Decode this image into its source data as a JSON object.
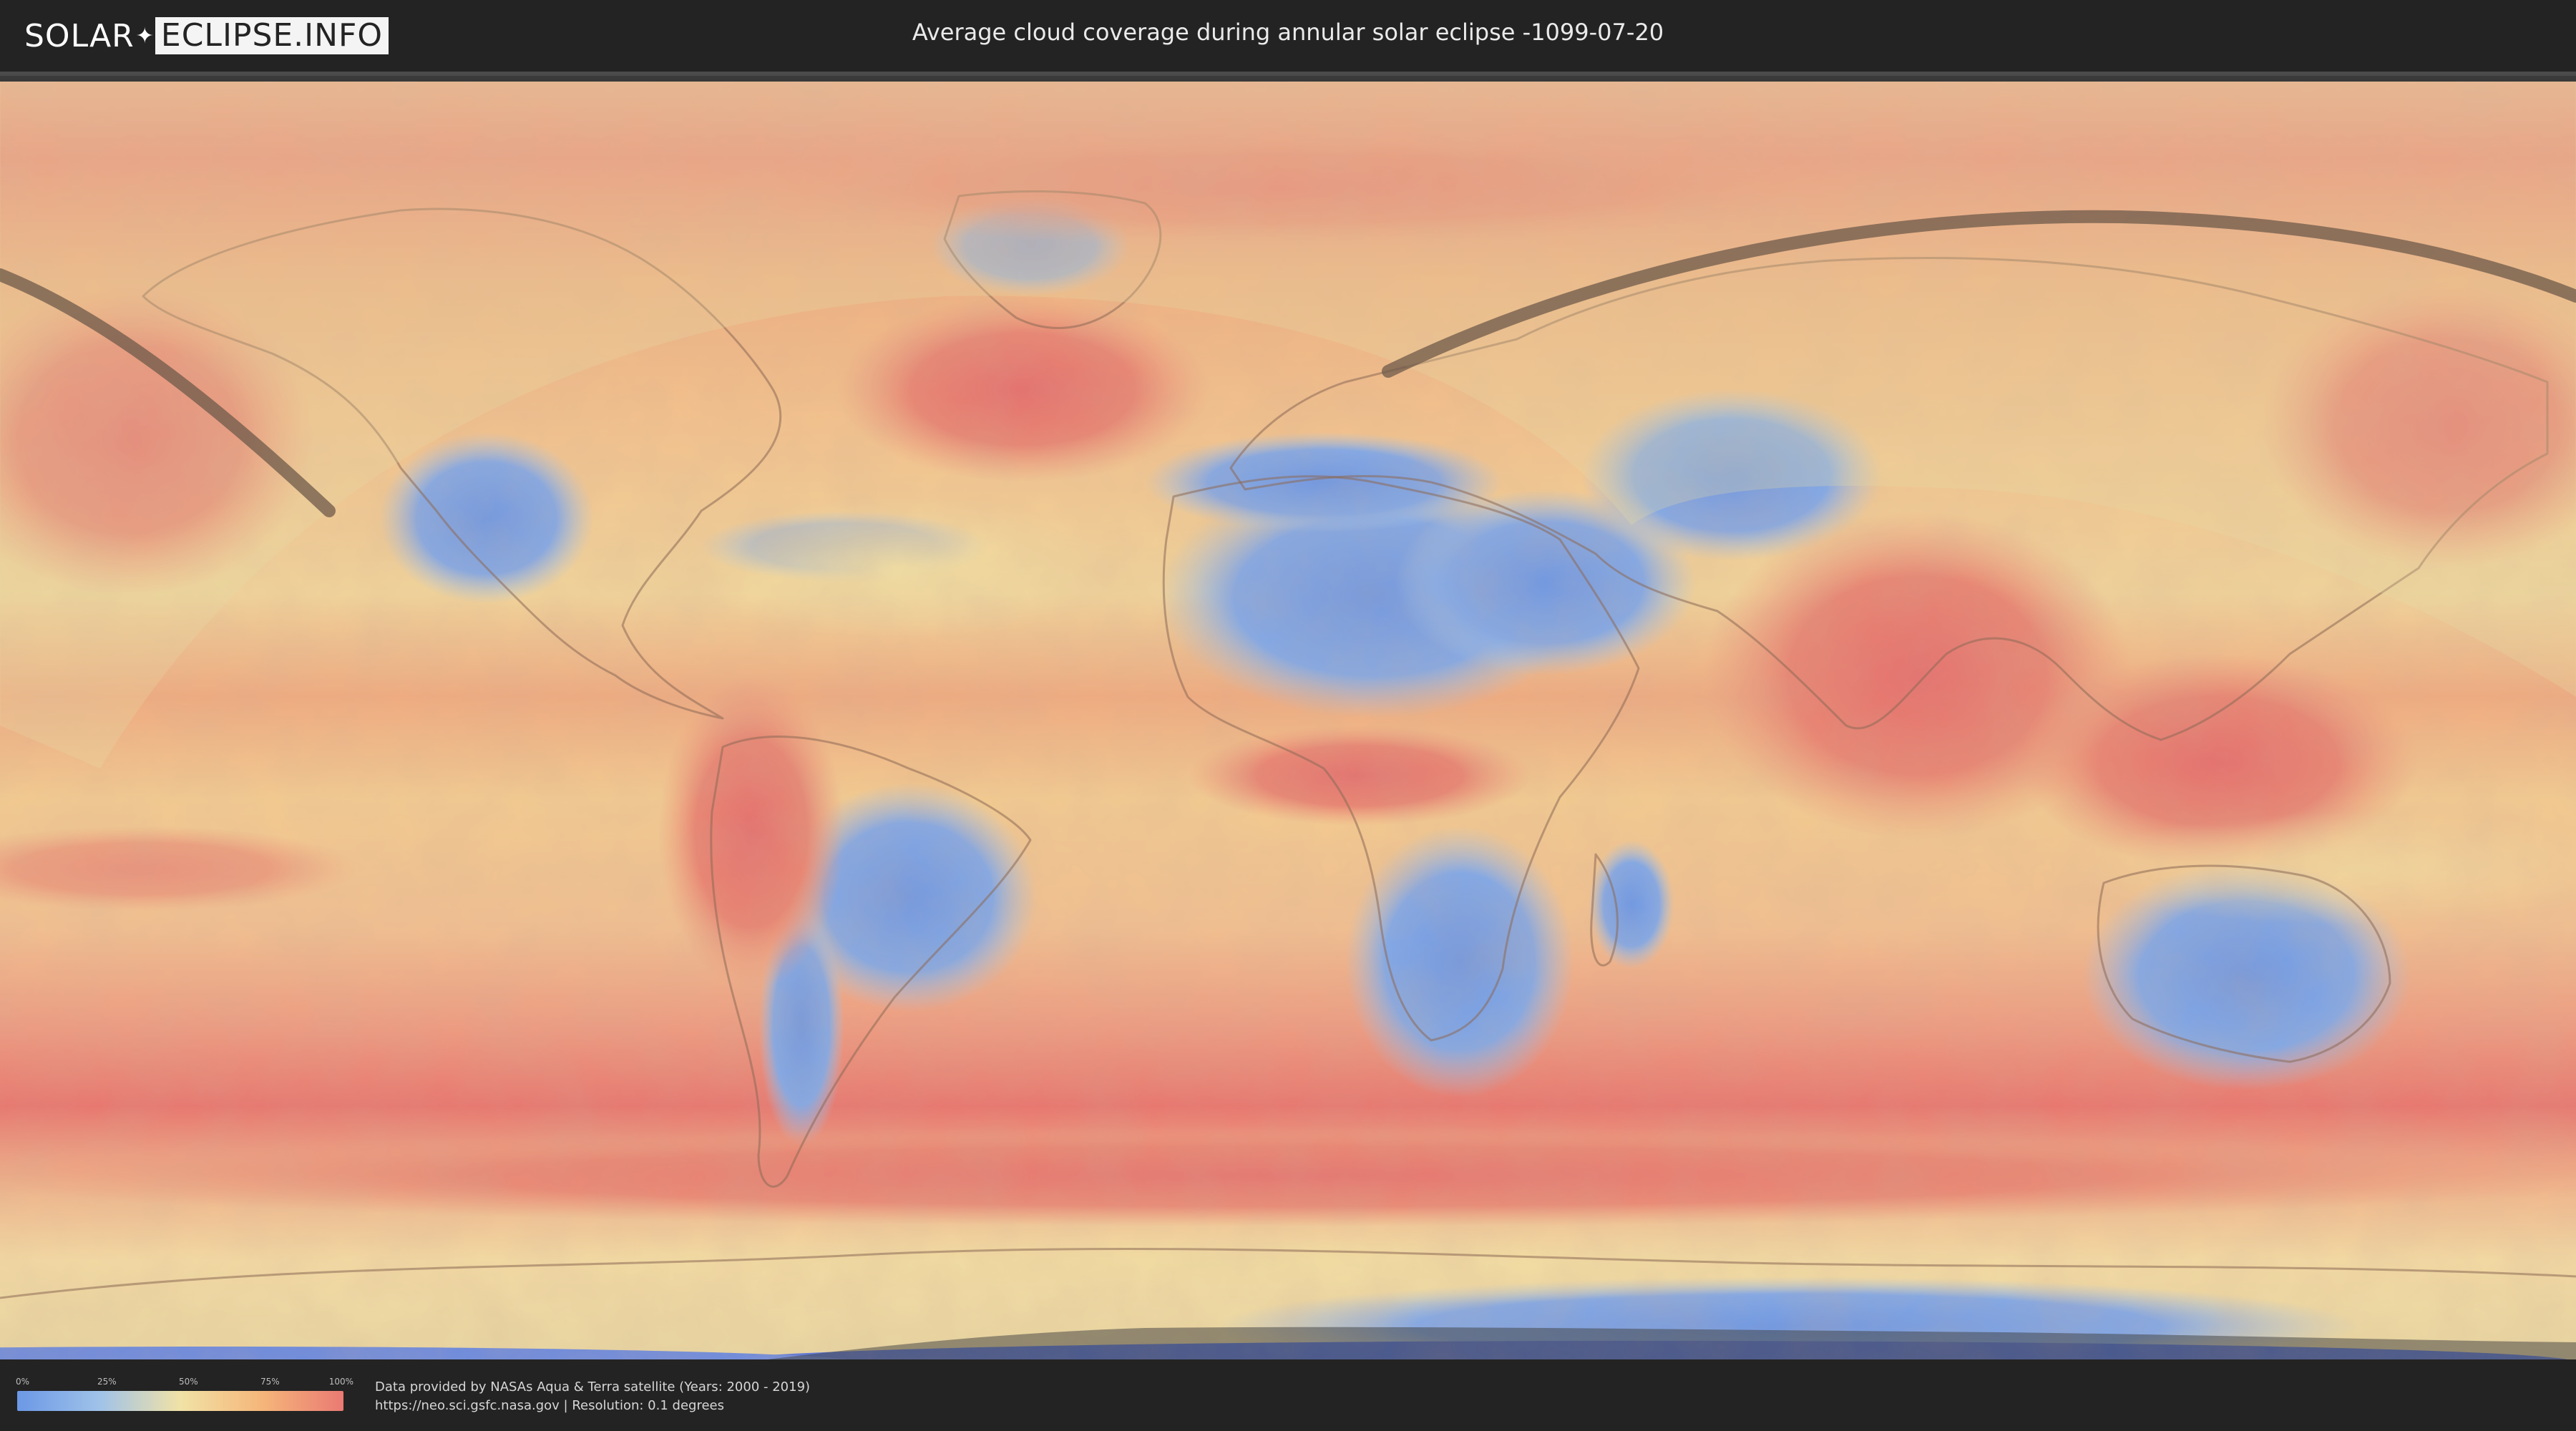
{
  "header": {
    "logo_left": "SOLAR",
    "logo_right": "ECLIPSE.INFO",
    "title": "Average cloud coverage during annular solar eclipse -1099-07-20"
  },
  "legend": {
    "ticks": [
      "0%",
      "25%",
      "50%",
      "75%",
      "100%"
    ],
    "colors": [
      "#6b98e6",
      "#9fc2e9",
      "#f1e2a6",
      "#f5b67a",
      "#ea7a73"
    ]
  },
  "footer": {
    "credit": "Data provided by NASAs Aqua & Terra satellite (Years: 2000 - 2019)",
    "source": "https://neo.sci.gsfc.nasa.gov | Resolution: 0.1 degrees"
  },
  "map": {
    "projection": "equirectangular",
    "colors": {
      "cloud_low": "#6b98e6",
      "cloud_mid": "#f1e2a6",
      "cloud_high": "#ea7a73",
      "eclipse_path": "#6e5a4a",
      "no_data": "#3e3e3e"
    }
  }
}
